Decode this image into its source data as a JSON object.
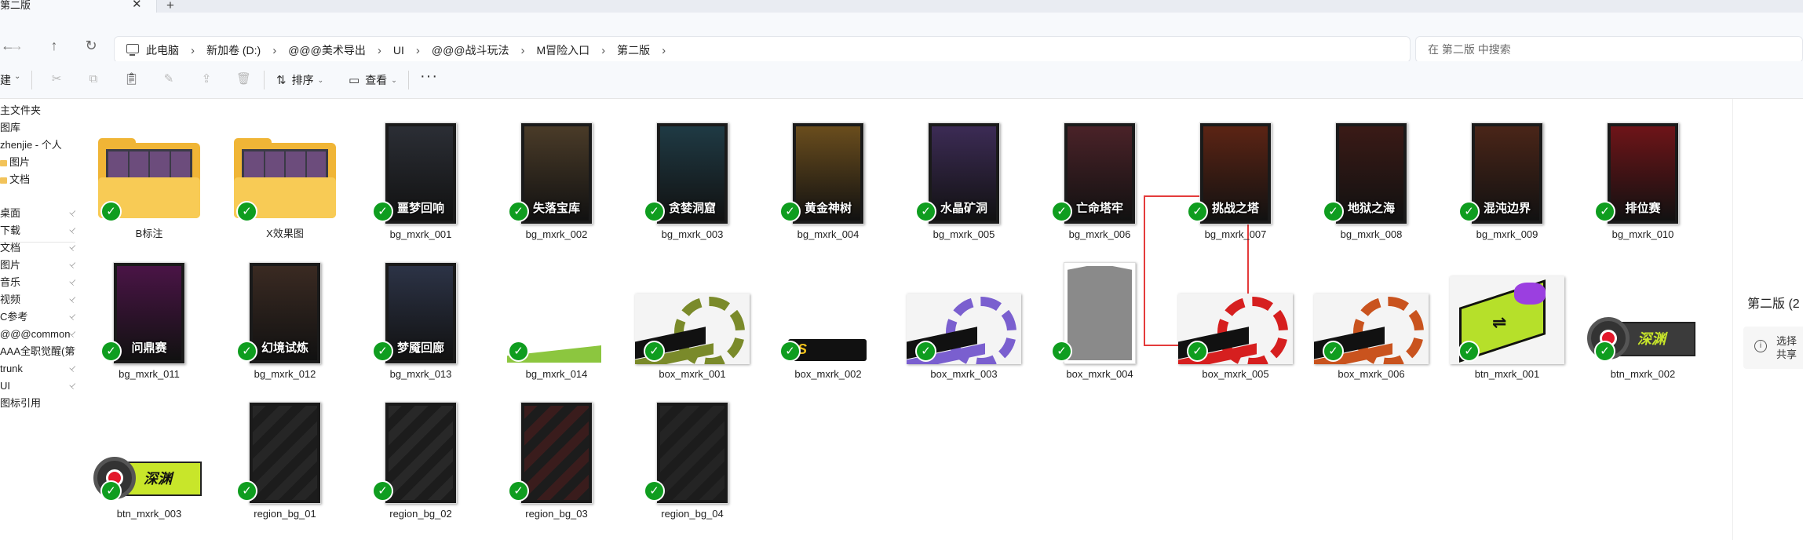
{
  "tab": {
    "title": "第二版",
    "close": "✕",
    "new": "+"
  },
  "nav": {
    "back": "←",
    "forward": "→",
    "up": "↑",
    "refresh": "↻"
  },
  "breadcrumbs": [
    "此电脑",
    "新加卷 (D:)",
    "@@@美术导出",
    "UI",
    "@@@战斗玩法",
    "M冒险入口",
    "第二版"
  ],
  "breadcrumb_sep": "›",
  "search": {
    "placeholder": "在 第二版 中搜索"
  },
  "toolbar": {
    "new_label": "新建",
    "sort_label": "排序",
    "view_label": "查看",
    "more": "···"
  },
  "sidebar": {
    "items": [
      {
        "label": "主文件夹",
        "pinned": false
      },
      {
        "label": "图库",
        "pinned": false
      },
      {
        "label": "zhenjie - 个人",
        "pinned": false
      },
      {
        "label": "图片",
        "pinned": false,
        "folder": true
      },
      {
        "label": "文档",
        "pinned": false,
        "folder": true
      },
      {
        "label": "桌面",
        "pinned": true
      },
      {
        "label": "下载",
        "pinned": true
      },
      {
        "label": "文档",
        "pinned": true
      },
      {
        "label": "图片",
        "pinned": true
      },
      {
        "label": "音乐",
        "pinned": true
      },
      {
        "label": "视频",
        "pinned": true
      },
      {
        "label": "C参考",
        "pinned": true
      },
      {
        "label": "@@@common",
        "pinned": true
      },
      {
        "label": "AAA全职觉醒(第",
        "pinned": true
      },
      {
        "label": "trunk",
        "pinned": true
      },
      {
        "label": "UI",
        "pinned": true
      },
      {
        "label": "图标引用",
        "pinned": false
      }
    ],
    "pin_glyph": "📌"
  },
  "files": [
    {
      "name": "B标注",
      "kind": "folder"
    },
    {
      "name": "X效果图",
      "kind": "folder"
    },
    {
      "name": "bg_mxrk_001",
      "kind": "portrait",
      "label": "噩梦回响",
      "color": "#2b2e35"
    },
    {
      "name": "bg_mxrk_002",
      "kind": "portrait",
      "label": "失落宝库",
      "color": "#4a3b28"
    },
    {
      "name": "bg_mxrk_003",
      "kind": "portrait",
      "label": "贪婪洞窟",
      "color": "#1f3a44"
    },
    {
      "name": "bg_mxrk_004",
      "kind": "portrait",
      "label": "黄金神树",
      "color": "#6a4d1d"
    },
    {
      "name": "bg_mxrk_005",
      "kind": "portrait",
      "label": "水晶矿洞",
      "color": "#3c2b55"
    },
    {
      "name": "bg_mxrk_006",
      "kind": "portrait",
      "label": "亡命塔牢",
      "color": "#4a2228"
    },
    {
      "name": "bg_mxrk_007",
      "kind": "portrait",
      "label": "挑战之塔",
      "color": "#5c2414"
    },
    {
      "name": "bg_mxrk_008",
      "kind": "portrait",
      "label": "地狱之海",
      "color": "#3a1a16"
    },
    {
      "name": "bg_mxrk_009",
      "kind": "portrait",
      "label": "混沌边界",
      "color": "#4a2518"
    },
    {
      "name": "bg_mxrk_010",
      "kind": "portrait",
      "label": "排位赛",
      "color": "#6e1418"
    },
    {
      "name": "bg_mxrk_011",
      "kind": "portrait",
      "label": "问鼎赛",
      "color": "#4a1446"
    },
    {
      "name": "bg_mxrk_012",
      "kind": "portrait",
      "label": "幻境试炼",
      "color": "#3a2a22"
    },
    {
      "name": "bg_mxrk_013",
      "kind": "portrait",
      "label": "梦魇回廊",
      "color": "#2c3346"
    },
    {
      "name": "bg_mxrk_014",
      "kind": "stripe",
      "color": "#8cc63f"
    },
    {
      "name": "box_mxrk_001",
      "kind": "gear",
      "color": "#7a8a2a"
    },
    {
      "name": "box_mxrk_002",
      "kind": "badge",
      "color": "#f2c21b"
    },
    {
      "name": "box_mxrk_003",
      "kind": "gear",
      "color": "#7a5fcf"
    },
    {
      "name": "box_mxrk_004",
      "kind": "gray",
      "color": "#8a8a8a"
    },
    {
      "name": "box_mxrk_005",
      "kind": "gear",
      "color": "#d61f1f"
    },
    {
      "name": "box_mxrk_006",
      "kind": "gear",
      "color": "#c9531e"
    },
    {
      "name": "btn_mxrk_001",
      "kind": "btnlime",
      "color": "#b6e02a"
    },
    {
      "name": "btn_mxrk_002",
      "kind": "btnbanner",
      "label": "深渊",
      "color": "#3b3b3b"
    },
    {
      "name": "btn_mxrk_003",
      "kind": "btnbanner",
      "label": "深渊",
      "color": "#c8e62a"
    },
    {
      "name": "region_bg_01",
      "kind": "dark",
      "color": "#262626"
    },
    {
      "name": "region_bg_02",
      "kind": "dark",
      "color": "#282828"
    },
    {
      "name": "region_bg_03",
      "kind": "dark",
      "color": "#3a1c1c"
    },
    {
      "name": "region_bg_04",
      "kind": "dark",
      "color": "#242424"
    }
  ],
  "selected_file": "bg_mxrk_006",
  "status_check": "✓",
  "details": {
    "title": "第二版 (2",
    "info_line1": "选择",
    "info_line2": "共享",
    "info_icon": "i"
  },
  "colors": {
    "check_green": "#0f9d1f",
    "selection_red": "#e43b3b",
    "folder_yellow": "#f0b536"
  }
}
